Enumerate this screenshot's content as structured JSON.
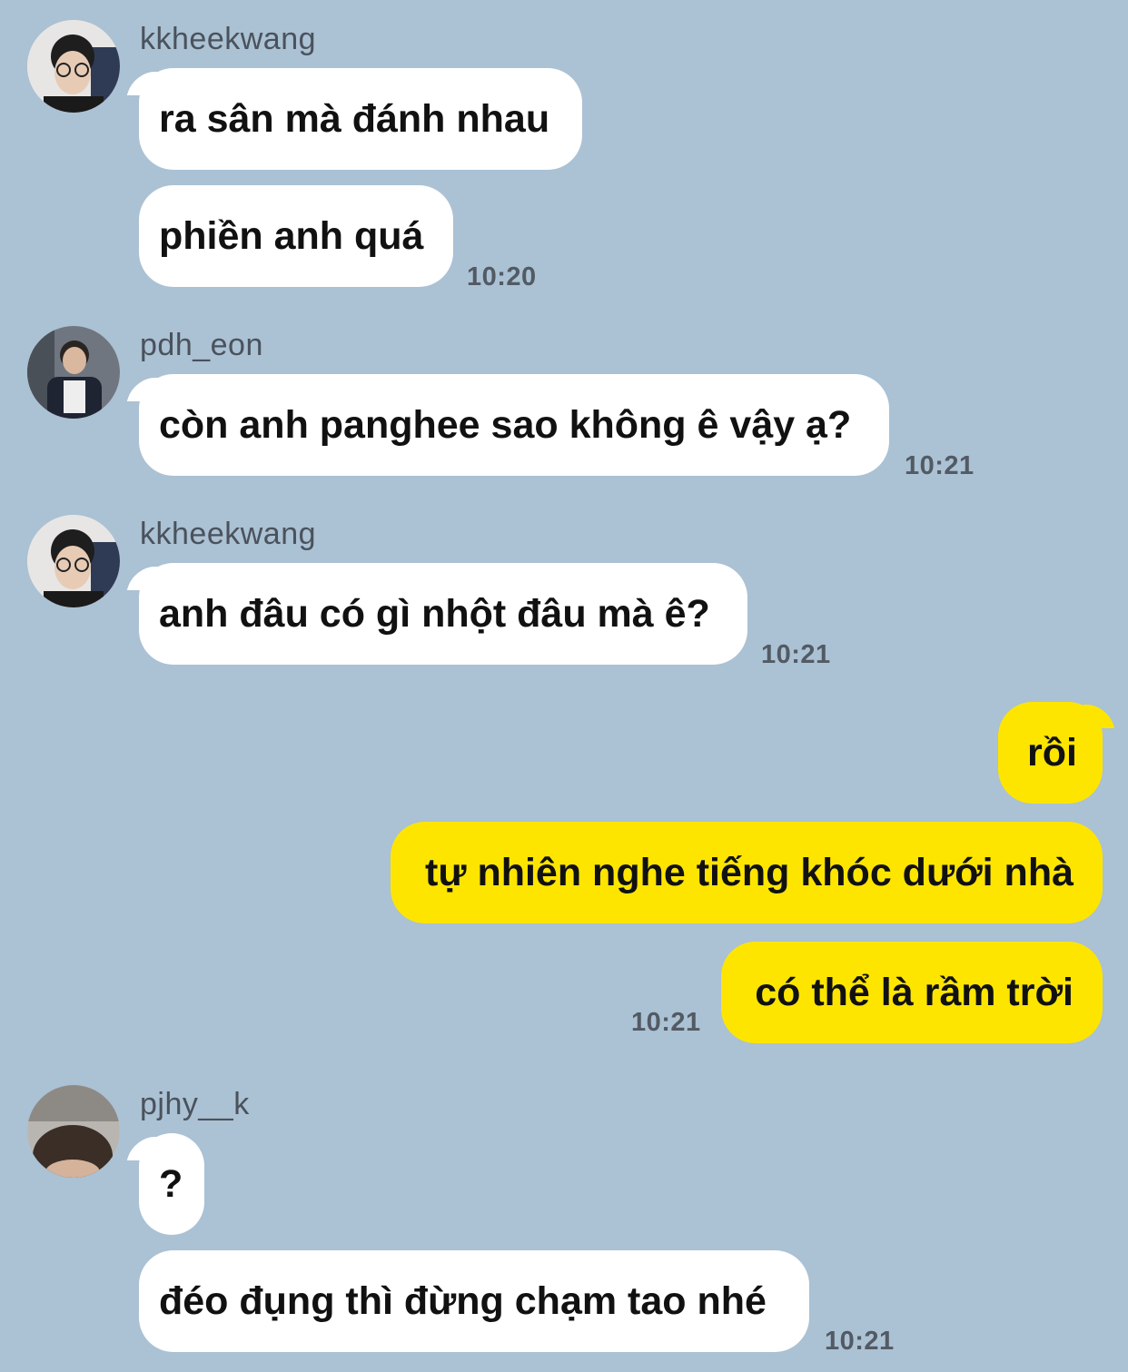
{
  "messages": [
    {
      "sender": "kkheekwang",
      "lines": [
        "ra sân mà đánh nhau",
        "phiền anh quá"
      ],
      "time": "10:20"
    },
    {
      "sender": "pdh_eon",
      "lines": [
        "còn anh panghee sao không ê vậy ạ?"
      ],
      "time": "10:21"
    },
    {
      "sender": "kkheekwang",
      "lines": [
        "anh đâu có gì nhột đâu mà ê?"
      ],
      "time": "10:21"
    },
    {
      "sender": "me",
      "lines": [
        "rồi",
        "tự nhiên nghe tiếng khóc dưới nhà",
        "có thể là rầm trời"
      ],
      "time": "10:21"
    },
    {
      "sender": "pjhy__k",
      "lines": [
        "?",
        "đéo đụng thì đừng chạm tao nhé"
      ],
      "time": "10:21"
    }
  ],
  "colors": {
    "background": "#abc1d4",
    "incoming_bubble": "#ffffff",
    "outgoing_bubble": "#fee500"
  }
}
